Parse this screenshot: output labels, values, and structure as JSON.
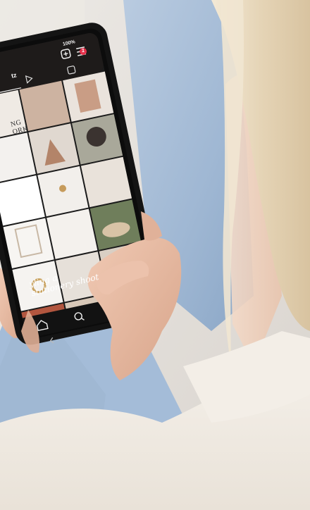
{
  "status_bar": {
    "battery": "100%"
  },
  "profile": {
    "username_fragment": "tz"
  },
  "notification": {
    "count": "1"
  },
  "posts": {
    "tile_text_top": "NG\nORK",
    "caption_bottom": "yling a\nstationery shoot"
  },
  "colors": {
    "background_left": "#e9e6e2",
    "jeans": "#a9bfd9",
    "sweater": "#f1ece6",
    "hair": "#e6d7be",
    "phone": "#141414",
    "skin": "#e3b8a0"
  }
}
